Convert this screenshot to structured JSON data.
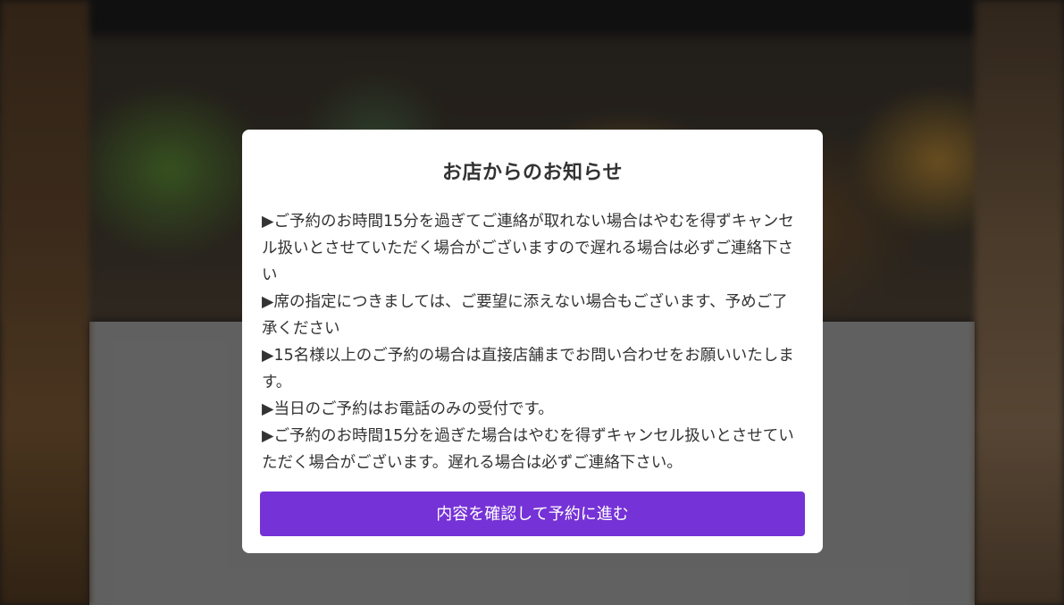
{
  "modal": {
    "title": "お店からのお知らせ",
    "notice_lines": [
      "▶ご予約のお時間15分を過ぎてご連絡が取れない場合はやむを得ずキャンセル扱いとさせていただく場合がございますので遅れる場合は必ずご連絡下さい",
      "▶席の指定につきましては、ご要望に添えない場合もございます、予めご了承ください",
      "▶15名様以上のご予約の場合は直接店舗までお問い合わせをお願いいたします。",
      "▶当日のご予約はお電話のみの受付です。",
      "▶ご予約のお時間15分を過ぎた場合はやむを得ずキャンセル扱いとさせていただく場合がございます。遅れる場合は必ずご連絡下さい。"
    ],
    "confirm_button_label": "内容を確認して予約に進む"
  },
  "colors": {
    "accent": "#7532d6",
    "modal_background": "#ffffff",
    "text": "#333333"
  }
}
